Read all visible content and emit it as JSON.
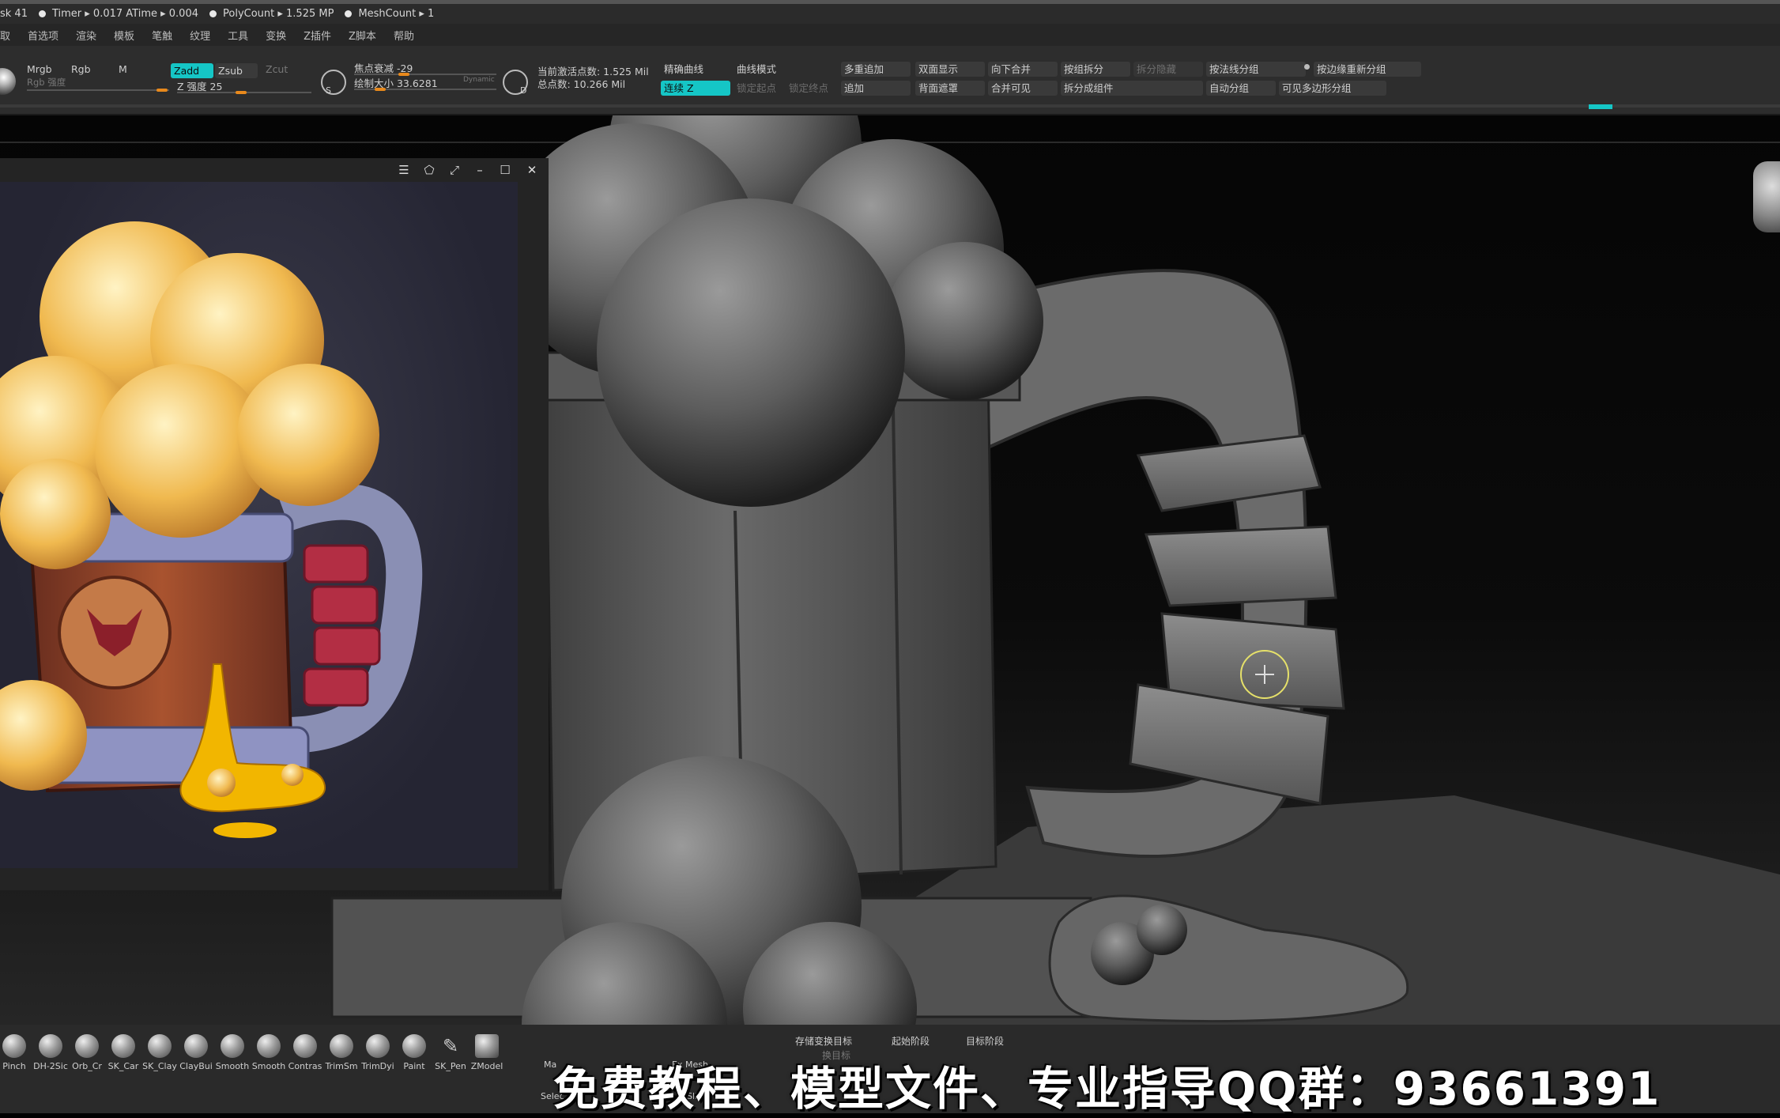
{
  "status": {
    "items": [
      "sk 41",
      "Timer ▸ 0.017 ATime ▸ 0.004",
      "PolyCount ▸ 1.525 MP",
      "MeshCount ▸ 1"
    ]
  },
  "menu": [
    "取",
    "首选项",
    "渲染",
    "模板",
    "笔触",
    "纹理",
    "工具",
    "变换",
    "Z插件",
    "Z脚本",
    "帮助"
  ],
  "shelf": {
    "mrgb": "Mrgb",
    "rgb": "Rgb",
    "m": "M",
    "rgb_intensity": "Rgb 强度",
    "zadd": "Zadd",
    "zsub": "Zsub",
    "zcut": "Zcut",
    "z_intensity": "Z 强度 25",
    "focal_shift": "焦点衰减 -29",
    "draw_size": "绘制大小 33.6281",
    "dynamic": "Dynamic",
    "active_points": "当前激活点数: 1.525 Mil",
    "total_points": "总点数: 10.266 Mil",
    "precise_curve": "精确曲线",
    "curve_mode": "曲线模式",
    "continuous_z": "连续 Z",
    "lock_start": "锁定起点",
    "lock_end": "锁定终点",
    "multi_append": "多重追加",
    "double_display": "双面显示",
    "merge_down": "向下合并",
    "split_by_group": "按组拆分",
    "split_hidden": "拆分隐藏",
    "group_by_normals": "按法线分组",
    "regroup_by_edge": "按边缘重新分组",
    "append": "追加",
    "back_mask": "背面遮罩",
    "merge_visible": "合并可见",
    "split_components": "拆分成组件",
    "auto_groups": "自动分组",
    "group_visible_polys": "可见多边形分组",
    "s_label": "S",
    "d_label": "D"
  },
  "brushes": [
    "Pinch",
    "DH-2Sic",
    "Orb_Cr",
    "SK_Car",
    "SK_Clay",
    "ClayBui",
    "Smooth",
    "Smooth",
    "Contras",
    "TrimSm",
    "TrimDyi",
    "Paint",
    "SK_Pen",
    "ZModel"
  ],
  "bottom_tools": {
    "ma": "Ma",
    "ex_mesh": "Ex Mesh",
    "store_morph": "存储变换目标",
    "start_stage": "起始阶段",
    "target_stage": "目标阶段",
    "switch_target": "换目标",
    "select": "Selec",
    "slice": "ir Slice"
  },
  "banner": "免费教程、模型文件、专业指导QQ群：93661391",
  "colors": {
    "accent": "#15c6c6",
    "slider_knob": "#e8891c"
  }
}
